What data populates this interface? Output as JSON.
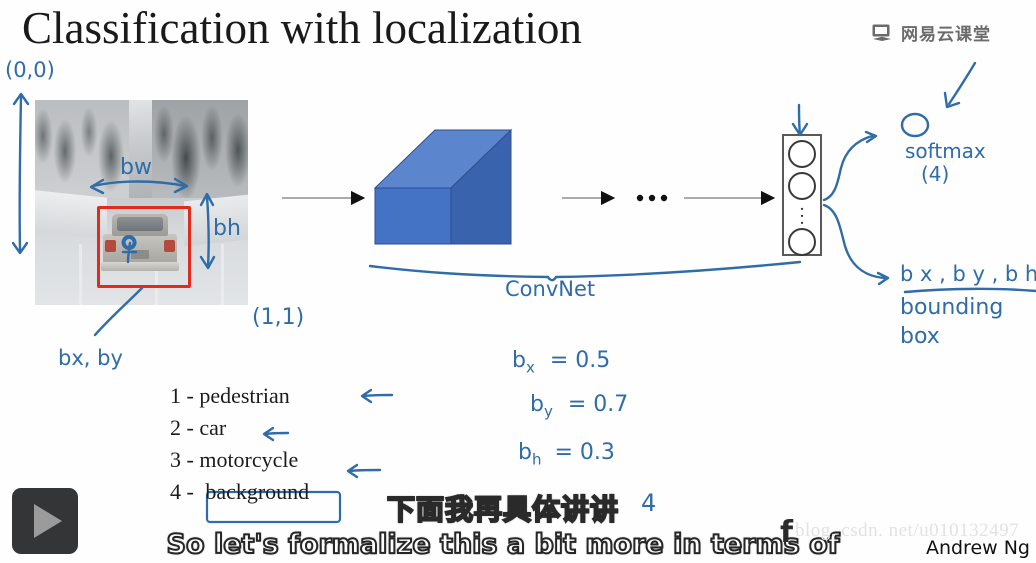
{
  "slide": {
    "title": "Classification with localization",
    "logo": {
      "icon": "monitor-icon",
      "text": "网易云课堂"
    },
    "signature": "Andrew Ng",
    "watermark": "blog. csdn. net/u010132497"
  },
  "photo": {
    "alt_description": "snowy road with SUV seen from behind",
    "bounding_box_color": "#e02b21",
    "annotations": {
      "origin": "(0,0)",
      "corner": "(1,1)",
      "width_label": "bw",
      "height_label": "bh",
      "center_label": "bx, by"
    }
  },
  "diagram": {
    "convnet_label": "ConvNet",
    "ellipsis": "...",
    "box_colors": {
      "front": "#4472c4",
      "top": "#5b85cd",
      "side": "#3a63ae"
    },
    "output_nodes": 3,
    "output_dots": "⋮"
  },
  "classes": {
    "items": [
      {
        "num": "1 -",
        "label": "pedestrian"
      },
      {
        "num": "2 -",
        "label": "car"
      },
      {
        "num": "3 -",
        "label": "motorcycle"
      },
      {
        "num": "4 -",
        "label": "background"
      }
    ],
    "highlighted": "background"
  },
  "equations": [
    {
      "lhs": "b",
      "sub": "x",
      "rhs": "= 0.5"
    },
    {
      "lhs": "b",
      "sub": "y",
      "rhs": "= 0.7"
    },
    {
      "lhs": "b",
      "sub": "h",
      "rhs": "= 0.3"
    }
  ],
  "annotations": {
    "softmax_line1": "softmax",
    "softmax_line2": "(4)",
    "bbox_line1": "b x , b y , b h , b w",
    "bbox_line2": "bounding",
    "bbox_line3": "box",
    "stray_mark": "4"
  },
  "ink_color": "#2f6ca8",
  "subtitles": {
    "chinese": "下面我再具体讲讲",
    "english": "So let's formalize this a bit more in terms of"
  },
  "player": {
    "play_label": "▶"
  }
}
